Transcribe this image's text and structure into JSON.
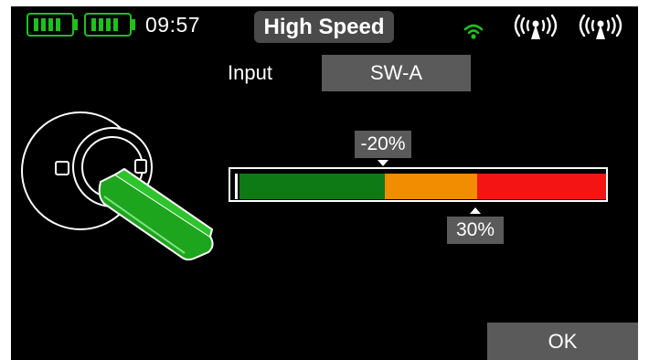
{
  "status": {
    "time": "09:57",
    "batteries": [
      {
        "name": "battery-1",
        "cells": 4
      },
      {
        "name": "battery-2",
        "cells": 4
      }
    ],
    "icons": [
      "wifi-icon",
      "antenna-signal-icon",
      "antenna-signal-icon"
    ]
  },
  "header": {
    "title": "High Speed"
  },
  "input": {
    "label": "Input",
    "value": "SW-A"
  },
  "range": {
    "low_label": "-20%",
    "high_label": "30%",
    "low_percent": -20,
    "high_percent": 30,
    "cursor": "min"
  },
  "footer": {
    "ok_label": "OK"
  },
  "colors": {
    "background": "#000000",
    "accent_green": "#1fbf1f",
    "segment_green": "#0e7a16",
    "segment_orange": "#f28c00",
    "segment_red": "#f41414",
    "box_gray": "#5a5a5a",
    "title_gray": "#4a4a4a"
  }
}
